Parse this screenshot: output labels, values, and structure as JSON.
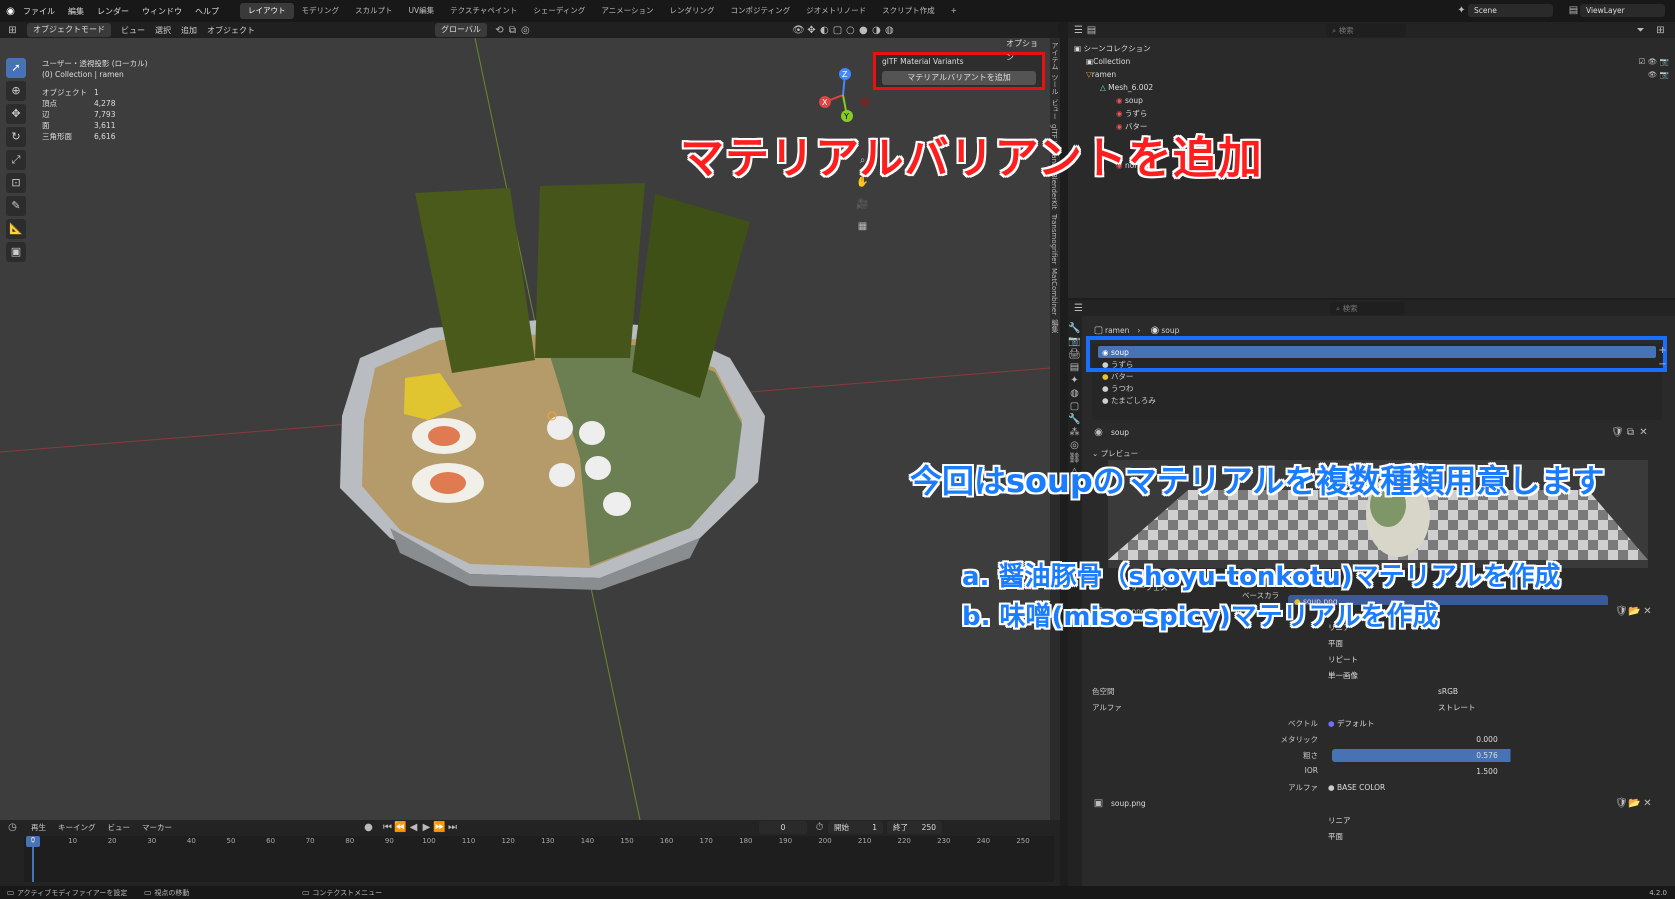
{
  "topbar": {
    "menus": [
      "ファイル",
      "編集",
      "レンダー",
      "ウィンドウ",
      "ヘルプ"
    ],
    "workspaces": [
      "レイアウト",
      "モデリング",
      "スカルプト",
      "UV編集",
      "テクスチャペイント",
      "シェーディング",
      "アニメーション",
      "レンダリング",
      "コンポジティング",
      "ジオメトリノード",
      "スクリプト作成",
      "+"
    ],
    "scene": "Scene",
    "view_layer": "ViewLayer"
  },
  "viewport_header": {
    "mode": "オブジェクトモード",
    "menus": [
      "ビュー",
      "選択",
      "追加",
      "オブジェクト"
    ],
    "transform": "グローバル",
    "options": "オプション",
    "search_placeholder": "検索"
  },
  "viewport_info": {
    "title": "ユーザー・透視投影 (ローカル)",
    "collection": "(0) Collection | ramen",
    "stats": [
      {
        "k": "オブジェクト",
        "v": "1"
      },
      {
        "k": "頂点",
        "v": "4,278"
      },
      {
        "k": "辺",
        "v": "7,793"
      },
      {
        "k": "面",
        "v": "3,611"
      },
      {
        "k": "三角形面",
        "v": "6,616"
      }
    ]
  },
  "gltf_panel": {
    "title": "glTF Material Variants",
    "button": "マテリアルバリアントを追加"
  },
  "sidetabs": [
    "アイテム",
    "ツール",
    "ビュー",
    "glTF Variants",
    "BlenderKit",
    "Transmogrifier",
    "MatCombiner",
    "編集"
  ],
  "axes": {
    "x": "X",
    "y": "Y",
    "z": "Z"
  },
  "timeline": {
    "menus": [
      "再生",
      "キーイング",
      "ビュー",
      "マーカー"
    ],
    "current_frame": "0",
    "start_label": "開始",
    "start": "1",
    "end_label": "終了",
    "end": "250",
    "ticks": [
      "0",
      "10",
      "20",
      "30",
      "40",
      "50",
      "60",
      "70",
      "80",
      "90",
      "100",
      "110",
      "120",
      "130",
      "140",
      "150",
      "160",
      "170",
      "180",
      "190",
      "200",
      "210",
      "220",
      "230",
      "240",
      "250"
    ]
  },
  "statusbar": {
    "items": [
      "アクティブモディファイアーを設定",
      "視点の移動",
      "コンテクストメニュー"
    ],
    "version": "4.2.0"
  },
  "outliner": {
    "search_placeholder": "検索",
    "items": [
      {
        "label": "シーンコレクション",
        "depth": 0,
        "icon": "collection"
      },
      {
        "label": "Collection",
        "depth": 1,
        "icon": "collection"
      },
      {
        "label": "ramen",
        "depth": 1,
        "icon": "object"
      },
      {
        "label": "Mesh_6.002",
        "depth": 2,
        "icon": "mesh"
      },
      {
        "label": "soup",
        "depth": 3,
        "icon": "material"
      },
      {
        "label": "うずら",
        "depth": 3,
        "icon": "material"
      },
      {
        "label": "バター",
        "depth": 3,
        "icon": "material"
      },
      {
        "label": "nori",
        "depth": 3,
        "icon": "material"
      }
    ]
  },
  "properties": {
    "search_placeholder": "検索",
    "breadcrumb": [
      "ramen",
      "soup"
    ],
    "slots": [
      "soup",
      "うずら",
      "バター",
      "うつわ",
      "たまごしろみ"
    ],
    "material_name": "soup",
    "preview_label": "プレビュー",
    "surface_label": "サーフェス",
    "base_color_label": "ベースカラー",
    "base_color_value": "soup.png",
    "image_name": "soup.png",
    "interp": [
      "リニア",
      "平面",
      "リピート",
      "単一画像"
    ],
    "color_space_label": "色空間",
    "color_space": "sRGB",
    "alpha_label": "アルファ",
    "alpha_mode": "ストレート",
    "vector_label": "ベクトル",
    "vector_value": "デフォルト",
    "metallic_label": "メタリック",
    "metallic": "0.000",
    "roughness_label": "粗さ",
    "roughness": "0.576",
    "ior_label": "IOR",
    "ior": "1.500",
    "alpha2_label": "アルファ",
    "alpha2_value": "BASE COLOR",
    "image2_name": "soup.png",
    "interp2": [
      "リニア",
      "平面"
    ]
  },
  "annotations": {
    "red": "マテリアルバリアントを追加",
    "blue_title": "今回はsoupのマテリアルを複数種類用意します",
    "blue_a": "a. 醤油豚骨（shoyu-tonkotu)マテリアルを作成",
    "blue_b": "b. 味噌(miso-spicy)マテリアルを作成"
  },
  "colors": {
    "accent": "#4772b3",
    "red_box": "#e81010",
    "blue_box": "#1a6fff"
  }
}
